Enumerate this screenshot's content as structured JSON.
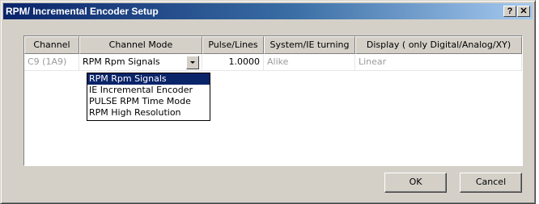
{
  "window": {
    "title": "RPM/ Incremental Encoder Setup",
    "help_glyph": "?",
    "close_glyph": "✕"
  },
  "table": {
    "columns": [
      "Channel",
      "Channel Mode",
      "Pulse/Lines",
      "System/IE turning",
      "Display ( only Digital/Analog/XY)"
    ],
    "rows": [
      {
        "channel": "C9 (1A9)",
        "mode": "RPM Rpm Signals",
        "pulse_lines": "1.0000",
        "system_ie_turning": "Alike",
        "display": "Linear"
      }
    ]
  },
  "dropdown": {
    "options": [
      "RPM Rpm Signals",
      "IE Incremental Encoder",
      "PULSE  RPM Time Mode",
      "RPM High Resolution"
    ],
    "selected_index": 0
  },
  "buttons": {
    "ok": "OK",
    "cancel": "Cancel"
  },
  "icons": {
    "combo_arrow": "chevron-down-icon",
    "help": "help-icon",
    "close": "close-icon"
  },
  "colors": {
    "title_gradient_start": "#0a246a",
    "title_gradient_end": "#a6caf0",
    "selection": "#0a246a",
    "face": "#d4d0c8"
  }
}
